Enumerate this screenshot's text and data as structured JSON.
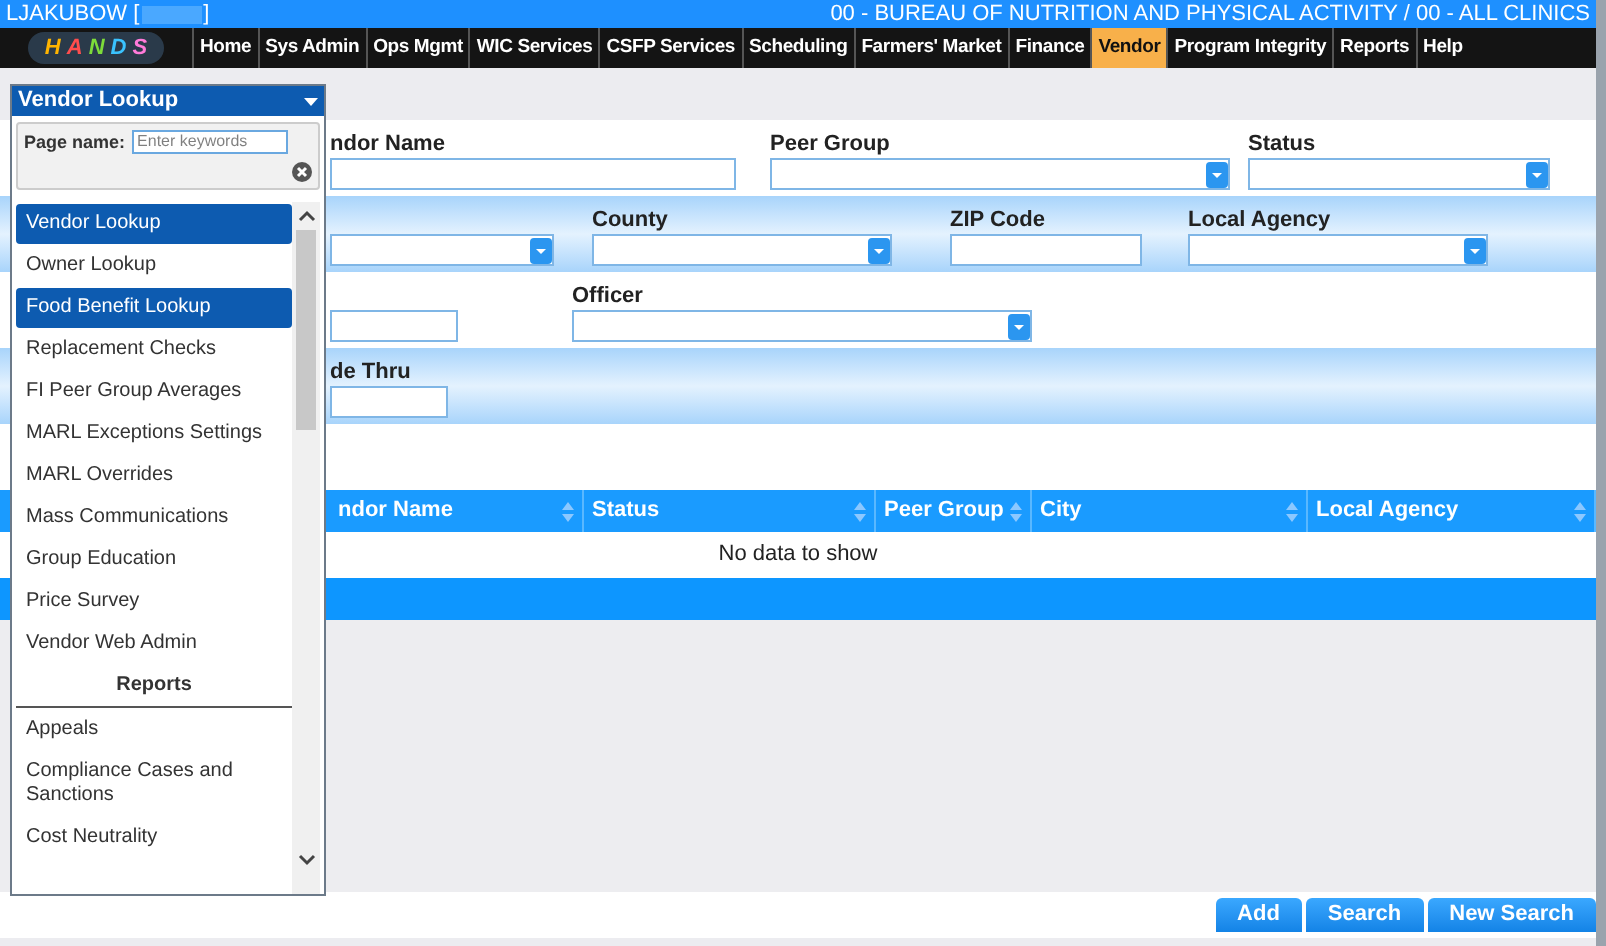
{
  "top_bar": {
    "user": "LJAKUBOW [",
    "user_end": "]",
    "agency": "00 - BUREAU OF NUTRITION AND PHYSICAL ACTIVITY / 00 - ALL CLINICS"
  },
  "logo": "HANDS",
  "nav": [
    {
      "label": "Home",
      "selected": false
    },
    {
      "label": "Sys Admin",
      "selected": false
    },
    {
      "label": "Ops Mgmt",
      "selected": false
    },
    {
      "label": "WIC Services",
      "selected": false
    },
    {
      "label": "CSFP Services",
      "selected": false
    },
    {
      "label": "Scheduling",
      "selected": false
    },
    {
      "label": "Farmers' Market",
      "selected": false
    },
    {
      "label": "Finance",
      "selected": false
    },
    {
      "label": "Vendor",
      "selected": true
    },
    {
      "label": "Program Integrity",
      "selected": false
    },
    {
      "label": "Reports",
      "selected": false
    },
    {
      "label": "Help",
      "selected": false
    }
  ],
  "form": {
    "rows": [
      {
        "fields": [
          {
            "label": "ndor Name",
            "kind": "text"
          },
          {
            "label": "Peer Group",
            "kind": "select"
          },
          {
            "label": "Status",
            "kind": "select"
          }
        ]
      },
      {
        "fields": [
          {
            "kind": "select"
          },
          {
            "label": "County",
            "kind": "select"
          },
          {
            "label": "ZIP Code",
            "kind": "text"
          },
          {
            "label": "Local Agency",
            "kind": "select"
          }
        ]
      },
      {
        "fields": [
          {
            "kind": "text"
          },
          {
            "label": "Officer",
            "kind": "select"
          }
        ]
      },
      {
        "fields": [
          {
            "label": "de Thru",
            "kind": "text"
          }
        ]
      }
    ]
  },
  "table": {
    "columns": [
      "ndor Name",
      "Status",
      "Peer Group",
      "City",
      "Local Agency"
    ],
    "empty_message": "No data to show"
  },
  "buttons": [
    "Add",
    "Search",
    "New Search"
  ],
  "menu": {
    "title": "Vendor Lookup",
    "search_label": "Page name:",
    "search_placeholder": "Enter keywords",
    "items": [
      {
        "label": "Vendor Lookup",
        "kind": "item",
        "selected": true
      },
      {
        "label": "Owner Lookup",
        "kind": "item",
        "selected": false
      },
      {
        "label": "Food Benefit Lookup",
        "kind": "item",
        "selected": true
      },
      {
        "label": "Replacement Checks",
        "kind": "item",
        "selected": false
      },
      {
        "label": "FI Peer Group Averages",
        "kind": "item",
        "selected": false
      },
      {
        "label": "MARL Exceptions Settings",
        "kind": "item",
        "selected": false
      },
      {
        "label": "MARL Overrides",
        "kind": "item",
        "selected": false
      },
      {
        "label": "Mass Communications",
        "kind": "item",
        "selected": false
      },
      {
        "label": "Group Education",
        "kind": "item",
        "selected": false
      },
      {
        "label": "Price Survey",
        "kind": "item",
        "selected": false
      },
      {
        "label": "Vendor Web Admin",
        "kind": "item",
        "selected": false
      },
      {
        "label": "Reports",
        "kind": "header"
      },
      {
        "label": "Appeals",
        "kind": "item",
        "selected": false
      },
      {
        "label": "Compliance Cases and Sanctions",
        "kind": "item",
        "selected": false
      },
      {
        "label": "Cost Neutrality",
        "kind": "item",
        "selected": false
      }
    ]
  }
}
